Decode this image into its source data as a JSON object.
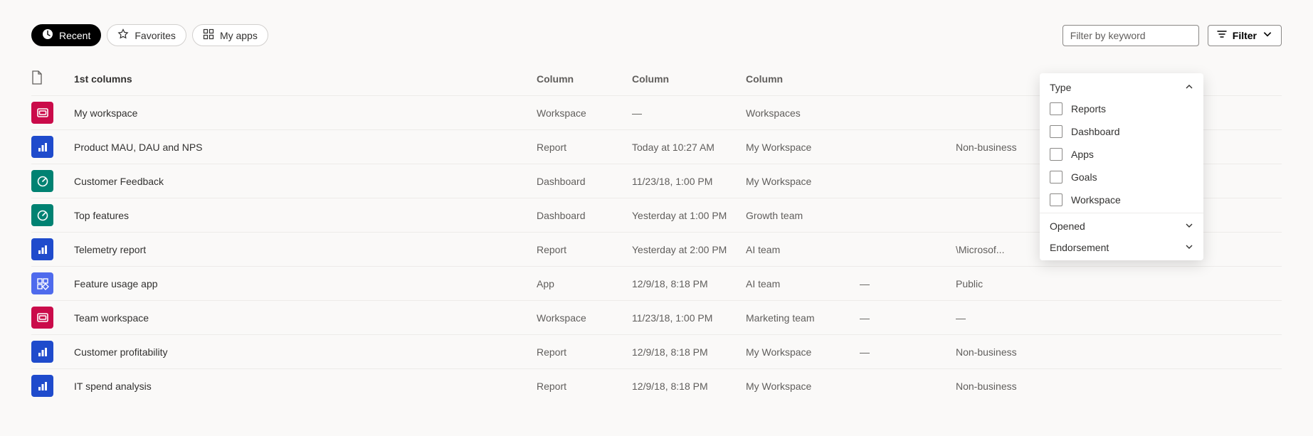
{
  "toolbar": {
    "chips": {
      "recent": "Recent",
      "favorites": "Favorites",
      "myapps": "My apps"
    },
    "search_placeholder": "Filter by keyword",
    "filter_label": "Filter"
  },
  "columns": {
    "name": "1st columns",
    "type": "Column",
    "time": "Column",
    "location": "Column"
  },
  "filter_panel": {
    "sections": {
      "type": "Type",
      "opened": "Opened",
      "endorsement": "Endorsement"
    },
    "type_options": [
      "Reports",
      "Dashboard",
      "Apps",
      "Goals",
      "Workspace"
    ]
  },
  "rows": [
    {
      "icon": "workspace",
      "name": "My workspace",
      "type": "Workspace",
      "time": "—",
      "location": "Workspaces"
    },
    {
      "icon": "report",
      "name": "Product MAU, DAU and NPS",
      "type": "Report",
      "time": "Today at 10:27 AM",
      "location": "My Workspace",
      "sensitivity": "Non-business"
    },
    {
      "icon": "dashboard",
      "name": "Customer Feedback",
      "type": "Dashboard",
      "time": "11/23/18, 1:00 PM",
      "location": "My Workspace"
    },
    {
      "icon": "dashboard",
      "name": "Top features",
      "type": "Dashboard",
      "time": "Yesterday at 1:00 PM",
      "location": "Growth team"
    },
    {
      "icon": "report",
      "name": "Telemetry report",
      "type": "Report",
      "time": "Yesterday at 2:00 PM",
      "location": "AI team",
      "sensitivity": "\\Microsof..."
    },
    {
      "icon": "app",
      "name": "Feature usage app",
      "type": "App",
      "time": "12/9/18, 8:18 PM",
      "location": "AI team",
      "endorsement": "—",
      "sensitivity": "Public"
    },
    {
      "icon": "workspace",
      "name": "Team workspace",
      "type": "Workspace",
      "time": "11/23/18, 1:00 PM",
      "location": "Marketing team",
      "endorsement": "—",
      "sensitivity": "—"
    },
    {
      "icon": "report",
      "name": "Customer profitability",
      "type": "Report",
      "time": "12/9/18, 8:18 PM",
      "location": "My Workspace",
      "endorsement": "—",
      "sensitivity": "Non-business"
    },
    {
      "icon": "report",
      "name": "IT spend analysis",
      "type": "Report",
      "time": "12/9/18, 8:18 PM",
      "location": "My Workspace",
      "sensitivity": "Non-business"
    }
  ]
}
